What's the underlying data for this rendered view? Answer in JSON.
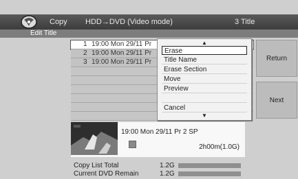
{
  "header": {
    "mode_label": "Copy",
    "path": "HDD→DVD (Video mode)",
    "title_count": "3  Title"
  },
  "subheader": {
    "label": "Edit Title"
  },
  "titles": [
    {
      "num": "1",
      "info": "19:00 Mon  29/11  Pr",
      "selected": true
    },
    {
      "num": "2",
      "info": "19:00 Mon  29/11  Pr",
      "selected": false
    },
    {
      "num": "3",
      "info": "19:00 Mon  29/11  Pr",
      "selected": false
    }
  ],
  "menu": {
    "items": [
      "Erase",
      "Title Name",
      "Erase Section",
      "Move",
      "Preview",
      "",
      "Cancel"
    ],
    "up_arrow": "▲",
    "down_arrow": "▼"
  },
  "buttons": {
    "return_label": "Return",
    "next_label": "Next"
  },
  "detail": {
    "datetime": "19:00 Mon 29/11   Pr 2   SP",
    "duration": "2h00m(1.0G)"
  },
  "stats": [
    {
      "label": "Copy List Total",
      "value": "1.2G"
    },
    {
      "label": "Current DVD Remain",
      "value": "1.2G"
    }
  ]
}
